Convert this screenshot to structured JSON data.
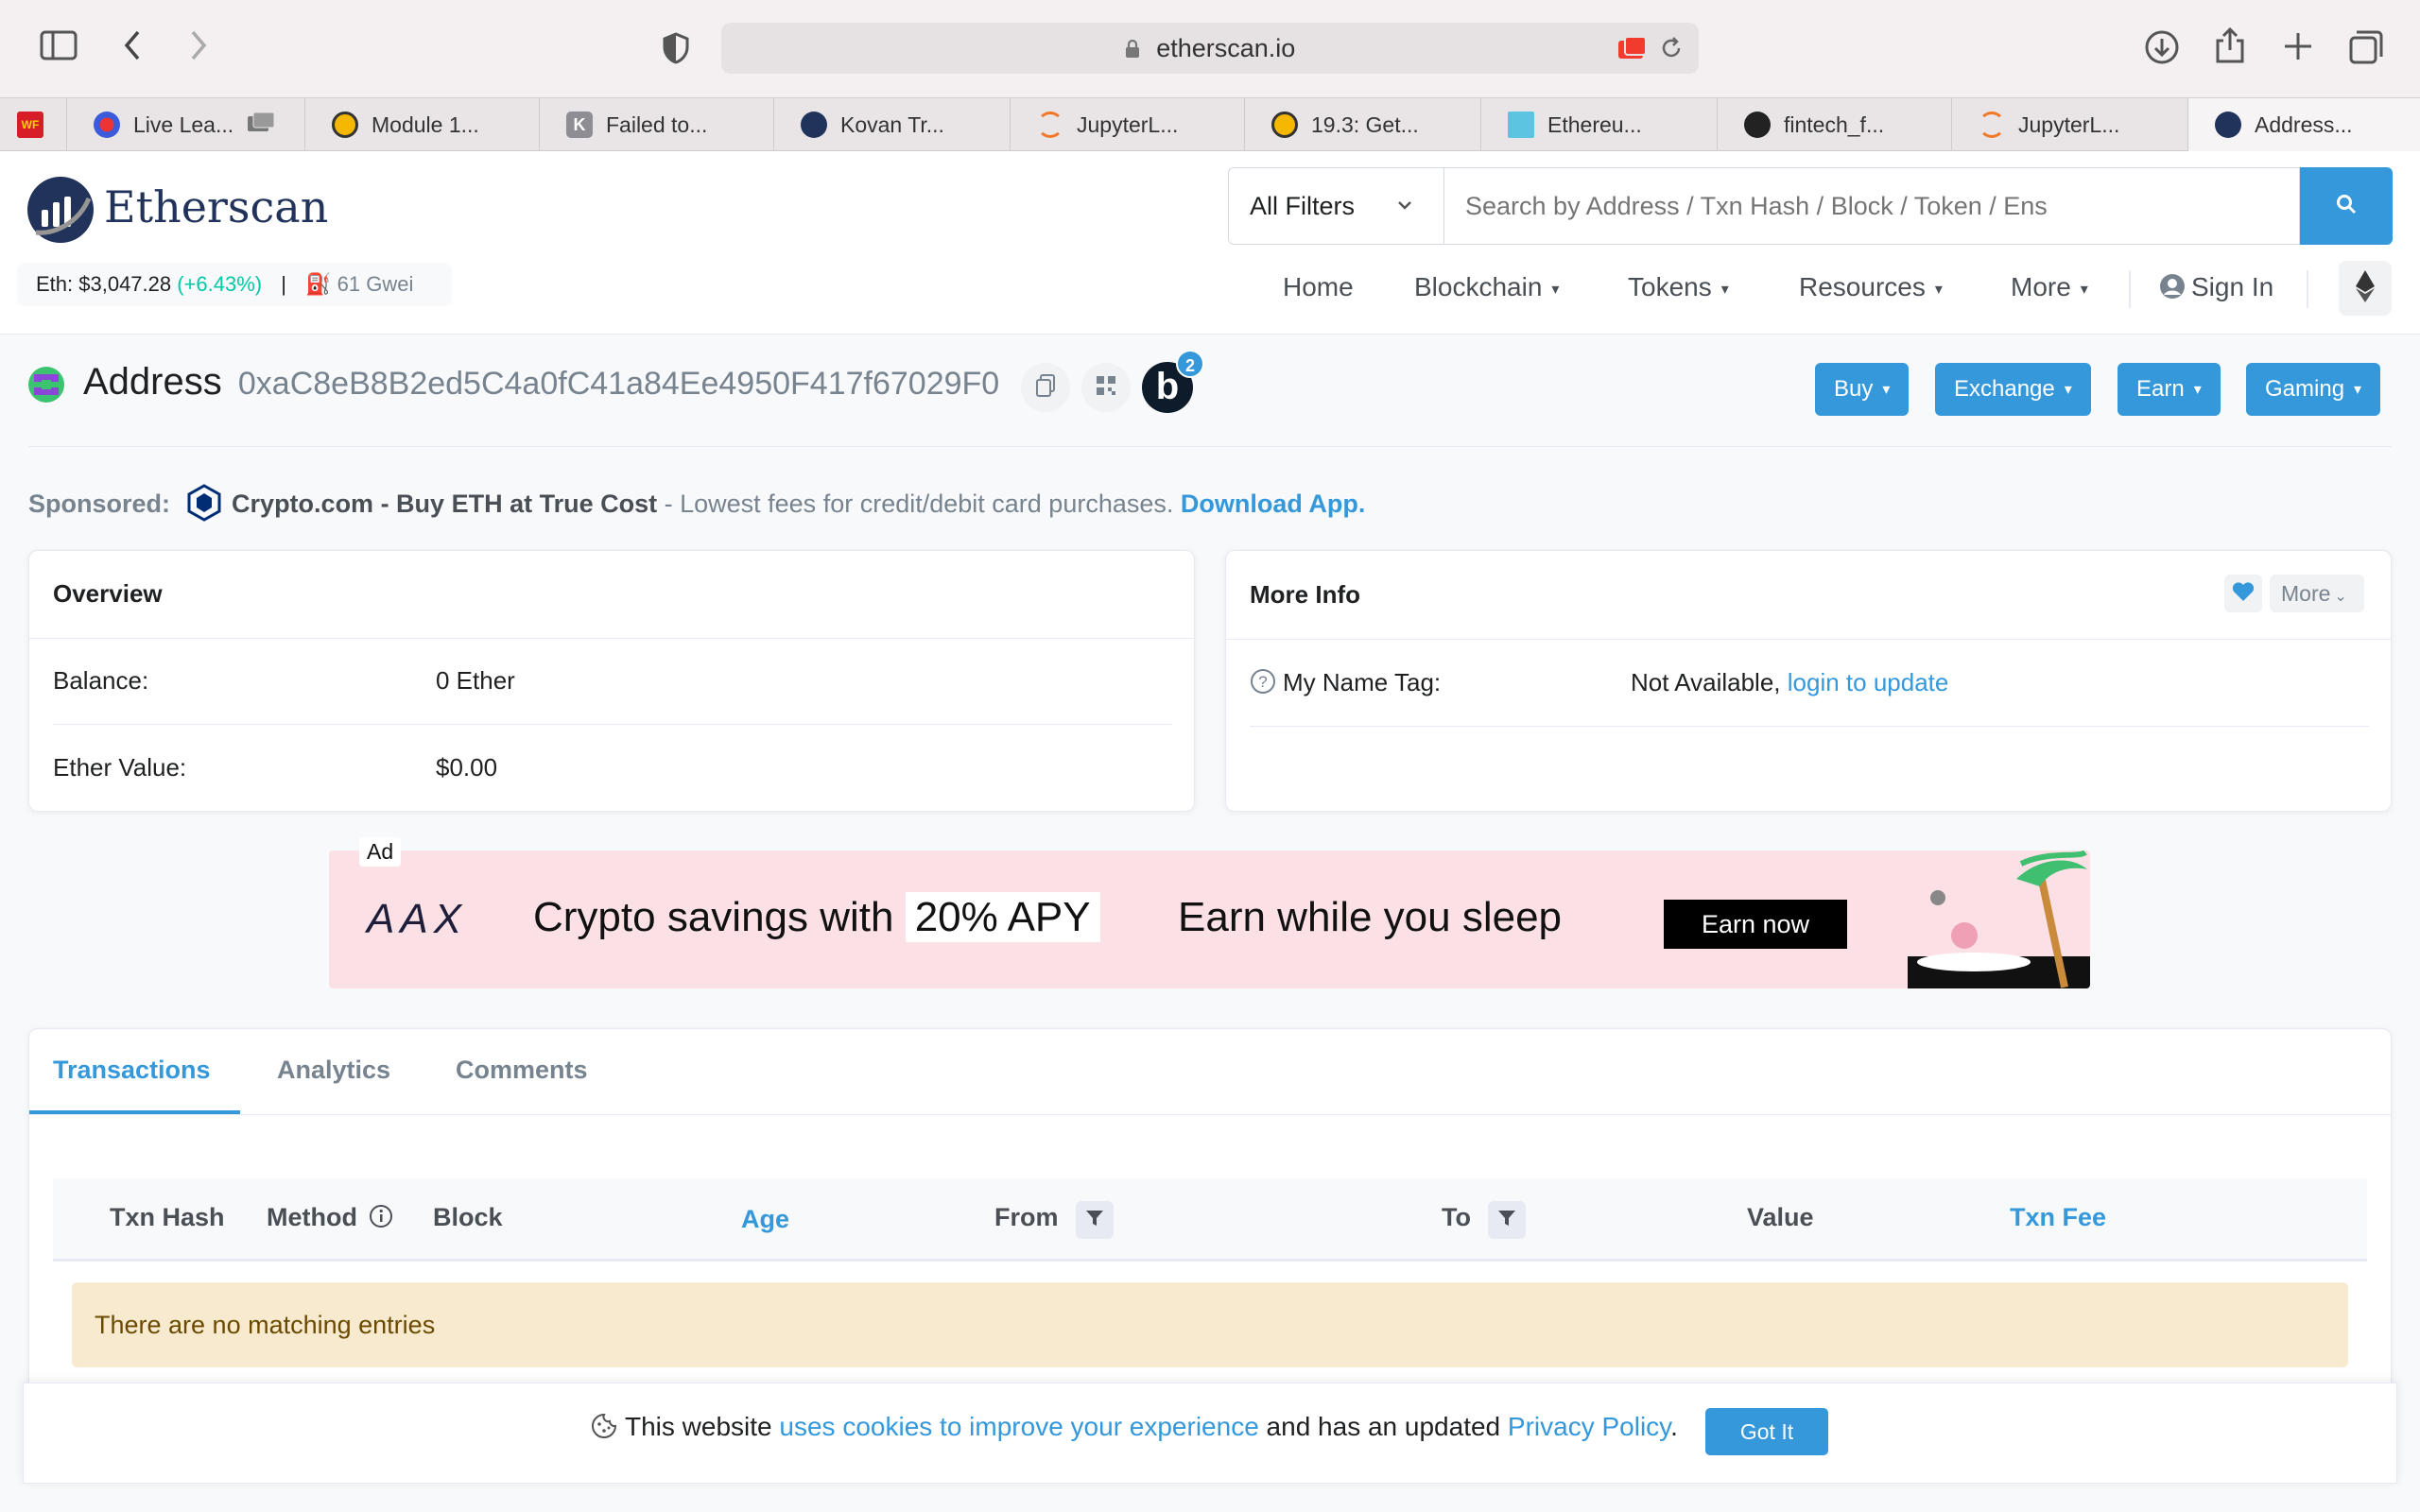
{
  "browser": {
    "url": "etherscan.io",
    "tabs": [
      {
        "label": ""
      },
      {
        "label": "Live Lea..."
      },
      {
        "label": "Module 1..."
      },
      {
        "label": "Failed to..."
      },
      {
        "label": "Kovan Tr..."
      },
      {
        "label": "JupyterL..."
      },
      {
        "label": "19.3: Get..."
      },
      {
        "label": "Ethereu..."
      },
      {
        "label": "fintech_f..."
      },
      {
        "label": "JupyterL..."
      },
      {
        "label": "Address..."
      }
    ],
    "wf_favicon_text": "WF"
  },
  "header": {
    "logo_text": "Etherscan",
    "price_label": "Eth: $3,047.28",
    "price_change": "(+6.43%)",
    "separator": "|",
    "gas": "61 Gwei",
    "filter_label": "All Filters",
    "search_placeholder": "Search by Address / Txn Hash / Block / Token / Ens",
    "nav": {
      "home": "Home",
      "blockchain": "Blockchain",
      "tokens": "Tokens",
      "resources": "Resources",
      "more": "More",
      "sign_in": "Sign In"
    }
  },
  "address": {
    "label": "Address",
    "value": "0xaC8eB8B2ed5C4a0fC41a84Ee4950F417f67029F0",
    "badge_letter": "b",
    "badge_count": "2",
    "buttons": {
      "buy": "Buy",
      "exchange": "Exchange",
      "earn": "Earn",
      "gaming": "Gaming"
    }
  },
  "sponsored": {
    "prefix": "Sponsored:",
    "title": "Crypto.com - Buy ETH at True Cost",
    "text": " - Lowest fees for credit/debit card purchases. ",
    "cta": "Download App."
  },
  "overview": {
    "title": "Overview",
    "balance_label": "Balance:",
    "balance_value": "0 Ether",
    "ether_value_label": "Ether Value:",
    "ether_value": "$0.00"
  },
  "more_info": {
    "title": "More Info",
    "more_button": "More",
    "name_tag_label": "My Name Tag:",
    "name_tag_value": "Not Available, ",
    "name_tag_link": "login to update"
  },
  "ad": {
    "tag": "Ad",
    "brand": "AAX",
    "text_1": "Crypto savings with ",
    "highlight": "20% APY",
    "text_2": "Earn while you sleep",
    "cta": "Earn now"
  },
  "tabs": {
    "transactions": "Transactions",
    "analytics": "Analytics",
    "comments": "Comments"
  },
  "table": {
    "columns": [
      "Txn Hash",
      "Method",
      "Block",
      "Age",
      "From",
      "To",
      "Value",
      "Txn Fee"
    ],
    "empty_message": "There are no matching entries"
  },
  "cookie": {
    "text_1": "This website ",
    "link_1": "uses cookies to improve your experience",
    "text_2": " and has an updated ",
    "link_2": "Privacy Policy",
    "text_3": ".",
    "button": "Got It"
  },
  "colors": {
    "accent": "#3498db",
    "brand_dark": "#21325b",
    "positive": "#00c9a7",
    "warning_bg": "#f7eacf"
  }
}
